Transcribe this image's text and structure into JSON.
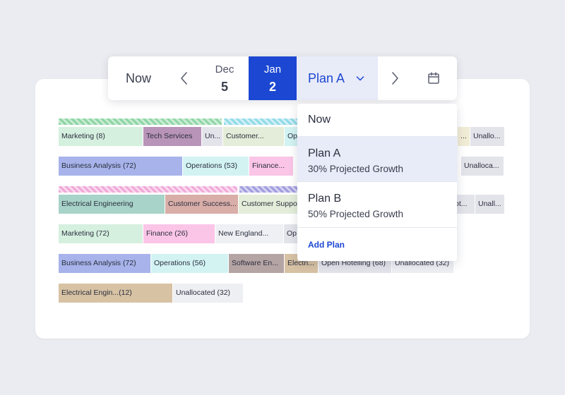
{
  "toolbar": {
    "now_label": "Now",
    "prev_month": "Dec",
    "prev_day": "5",
    "current_month": "Jan",
    "current_day": "2",
    "plan_label": "Plan A",
    "accent_color": "#1c47d2"
  },
  "dropdown": {
    "now_label": "Now",
    "options": [
      {
        "title": "Plan A",
        "subtitle": "30% Projected Growth",
        "selected": true
      },
      {
        "title": "Plan B",
        "subtitle": "50% Projected Growth",
        "selected": false
      }
    ],
    "add_label": "Add Plan"
  },
  "rows": [
    [
      "Marketing (8)",
      "Tech Services",
      "Un...",
      "Customer...",
      "Op",
      "...",
      "Unallo..."
    ],
    [
      "Business Analysis (72)",
      "Operations (53)",
      "Finance...",
      "Unalloca..."
    ],
    [
      "Electrical Engineering",
      "Customer Success...",
      "Customer Suppo",
      "ot...",
      "Unall..."
    ],
    [
      "Marketing (72)",
      "Finance (26)",
      "New England...",
      "Op"
    ],
    [
      "Business Analysis (72)",
      "Operations (56)",
      "Software En...",
      "Electri...",
      "Open Hotelling (68)",
      "Unallocated (32)"
    ],
    [
      "Electrical Engin...(12)",
      "Unallocated (32)"
    ]
  ],
  "colors": {
    "marketing": "#d6f0df",
    "tech_services": "#b894b8",
    "business_analysis": "#a7b3ea",
    "operations": "#d3f3f3",
    "finance": "#fbc5e7",
    "electrical": "#a8d3c8",
    "customer_success": "#d9aea8",
    "software": "#b5a4a4",
    "electrical_engin": "#d7c2a4",
    "unallocated": "#e3e4ea",
    "customer": "#e4edd9"
  }
}
